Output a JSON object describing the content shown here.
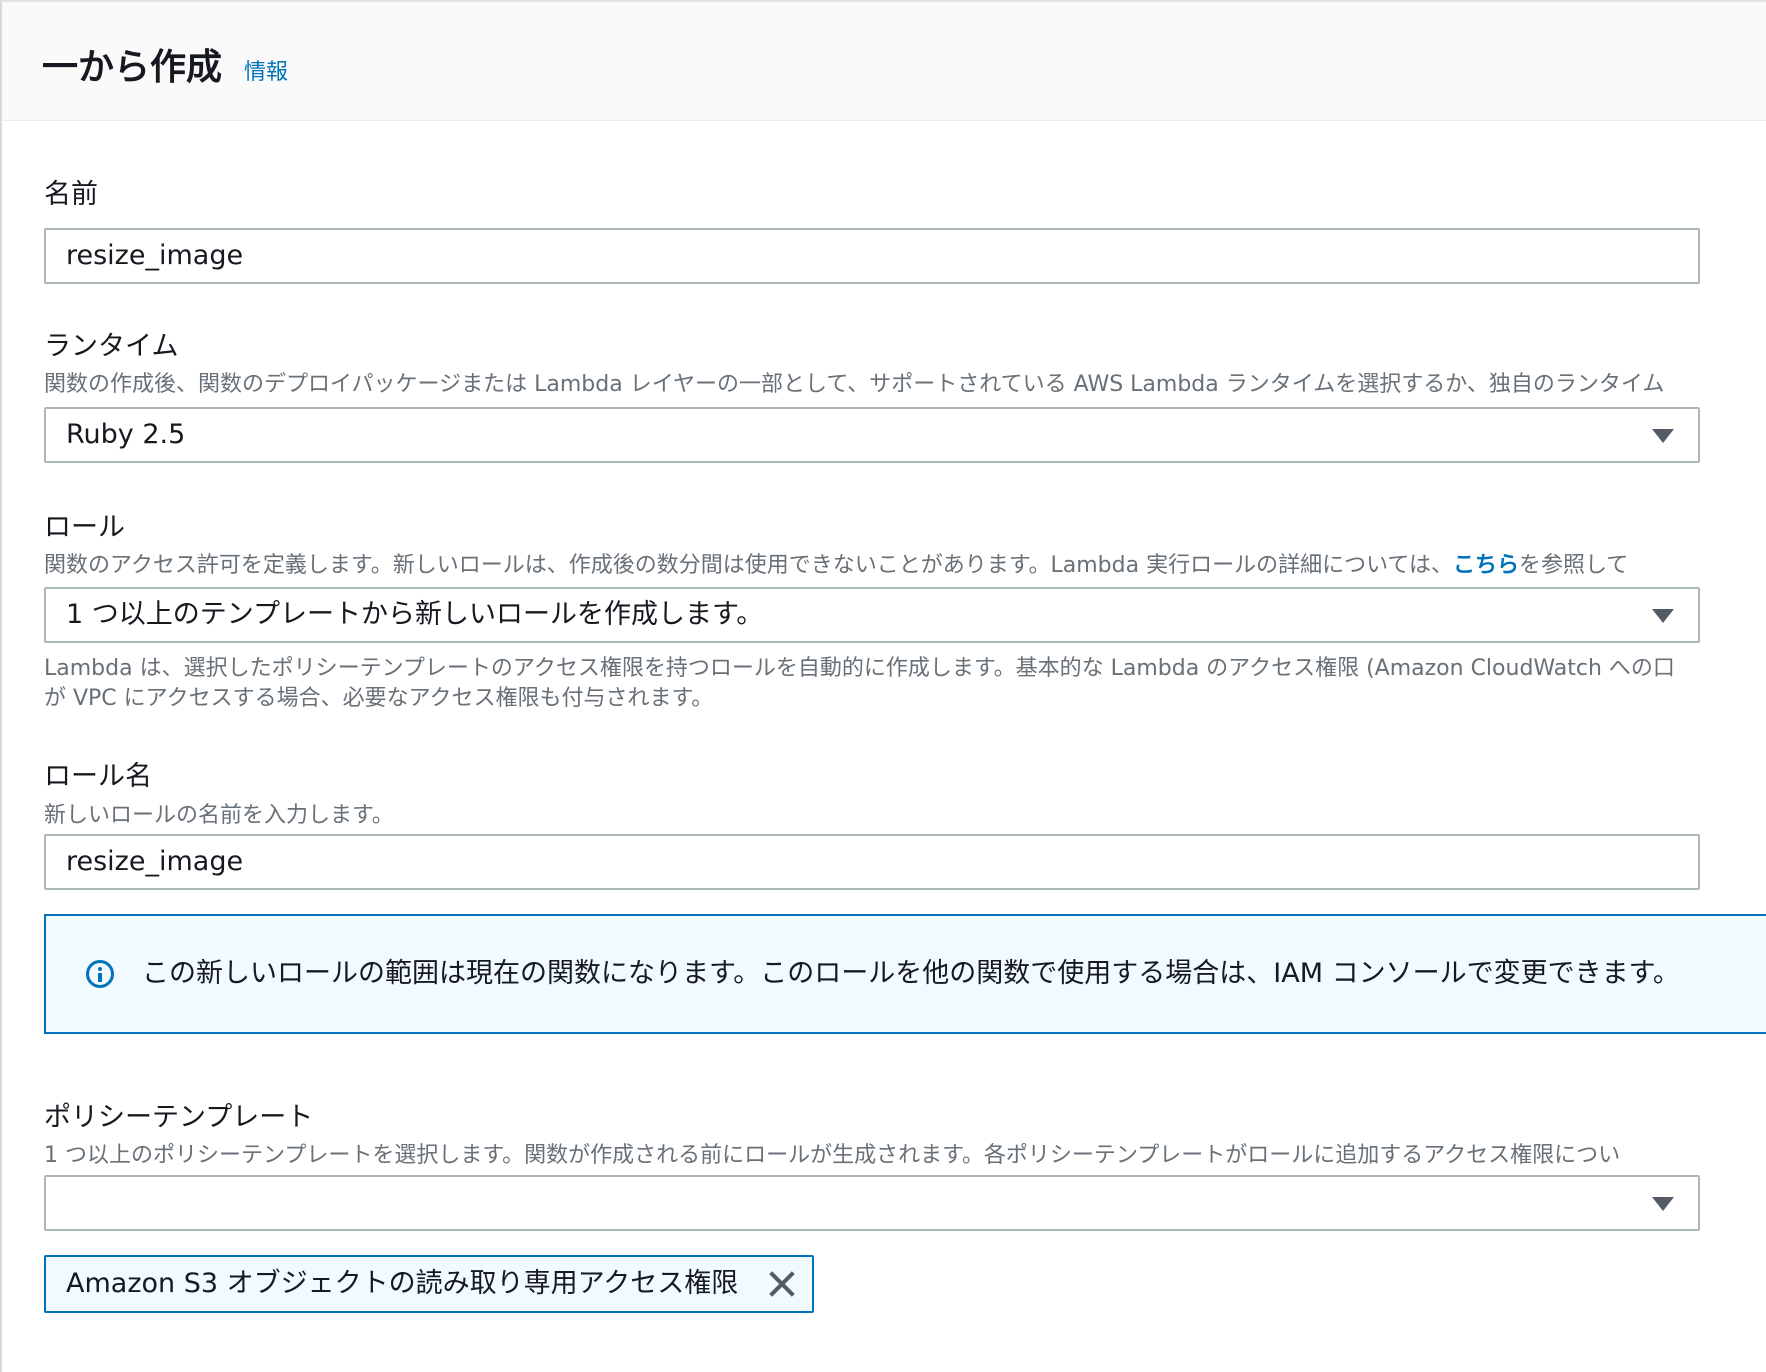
{
  "header": {
    "title": "一から作成",
    "info_link": "情報"
  },
  "name_section": {
    "label": "名前",
    "value": "resize_image"
  },
  "runtime_section": {
    "label": "ランタイム",
    "description": "関数の作成後、関数のデプロイパッケージまたは Lambda レイヤーの一部として、サポートされている AWS Lambda ランタイムを選択するか、独自のランタイム",
    "selected": "Ruby 2.5"
  },
  "role_section": {
    "label": "ロール",
    "description_before": "関数のアクセス許可を定義します。新しいロールは、作成後の数分間は使用できないことがあります。Lambda 実行ロールの詳細については、",
    "description_link": "こちら",
    "description_after": "を参照して",
    "selected": "1 つ以上のテンプレートから新しいロールを作成します。",
    "note_line1": "Lambda は、選択したポリシーテンプレートのアクセス権限を持つロールを自動的に作成します。基本的な Lambda のアクセス権限 (Amazon CloudWatch への口",
    "note_line2": "が VPC にアクセスする場合、必要なアクセス権限も付与されます。"
  },
  "role_name_section": {
    "label": "ロール名",
    "description": "新しいロールの名前を入力します。",
    "value": "resize_image"
  },
  "alert": {
    "icon": "info-icon",
    "text": "この新しいロールの範囲は現在の関数になります。このロールを他の関数で使用する場合は、IAM コンソールで変更できます。"
  },
  "policy_section": {
    "label": "ポリシーテンプレート",
    "description": "1 つ以上のポリシーテンプレートを選択します。関数が作成される前にロールが生成されます。各ポリシーテンプレートがロールに追加するアクセス権限につい",
    "selected": "",
    "token": "Amazon S3 オブジェクトの読み取り専用アクセス権限"
  },
  "colors": {
    "link": "#0073bb",
    "alert_bg": "#f1faff",
    "border": "#aab7b8"
  }
}
